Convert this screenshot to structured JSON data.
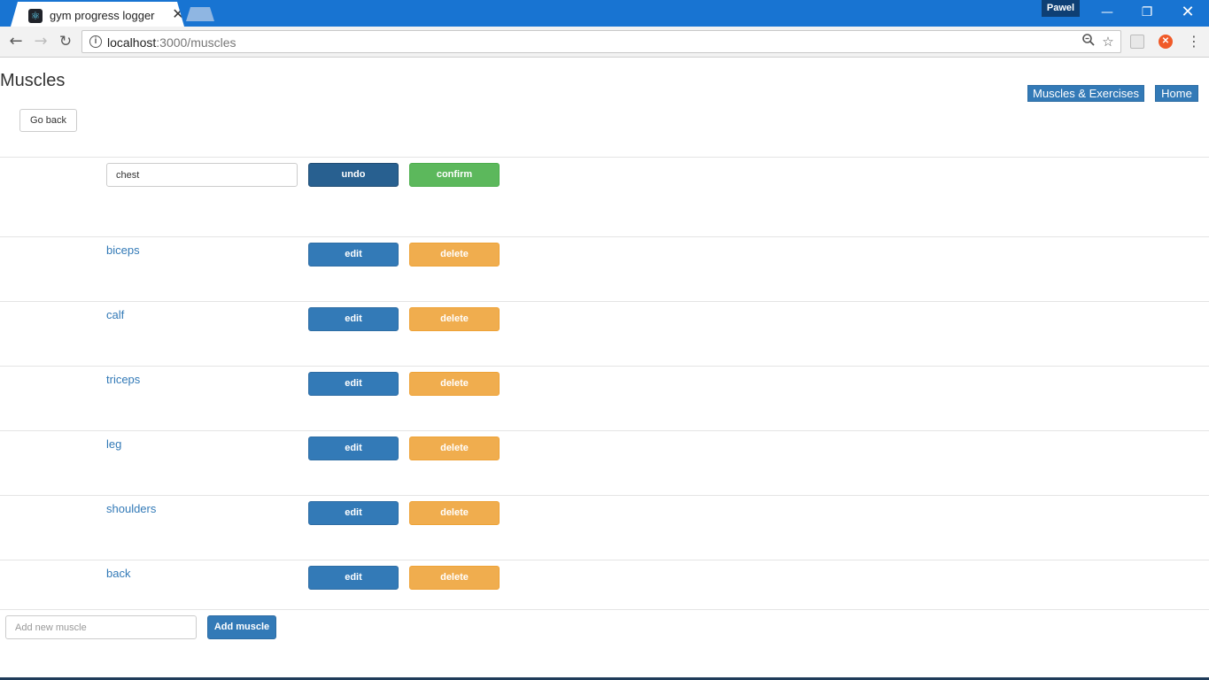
{
  "browser": {
    "tab_title": "gym progress logger",
    "tab_close": "✕",
    "profile_name": "Pawel",
    "url_host": "localhost",
    "url_path": ":3000/muscles",
    "win_min": "—",
    "win_max": "❐",
    "win_close": "✕"
  },
  "page": {
    "title": "Muscles",
    "go_back_label": "Go back",
    "nav_buttons": {
      "muscles_exercises": "Muscles & Exercises",
      "home": "Home"
    }
  },
  "editing": {
    "value": "chest",
    "undo_label": "undo",
    "confirm_label": "confirm"
  },
  "muscles": [
    {
      "name": "biceps",
      "edit_label": "edit",
      "delete_label": "delete"
    },
    {
      "name": "calf",
      "edit_label": "edit",
      "delete_label": "delete"
    },
    {
      "name": "triceps",
      "edit_label": "edit",
      "delete_label": "delete"
    },
    {
      "name": "leg",
      "edit_label": "edit",
      "delete_label": "delete"
    },
    {
      "name": "shoulders",
      "edit_label": "edit",
      "delete_label": "delete"
    },
    {
      "name": "back",
      "edit_label": "edit",
      "delete_label": "delete"
    }
  ],
  "add": {
    "placeholder": "Add new muscle",
    "button_label": "Add muscle"
  },
  "colors": {
    "primary": "#337ab7",
    "primary_active": "#286090",
    "success": "#5cb85c",
    "warning": "#f0ad4e",
    "chrome_blue": "#1874d2"
  }
}
